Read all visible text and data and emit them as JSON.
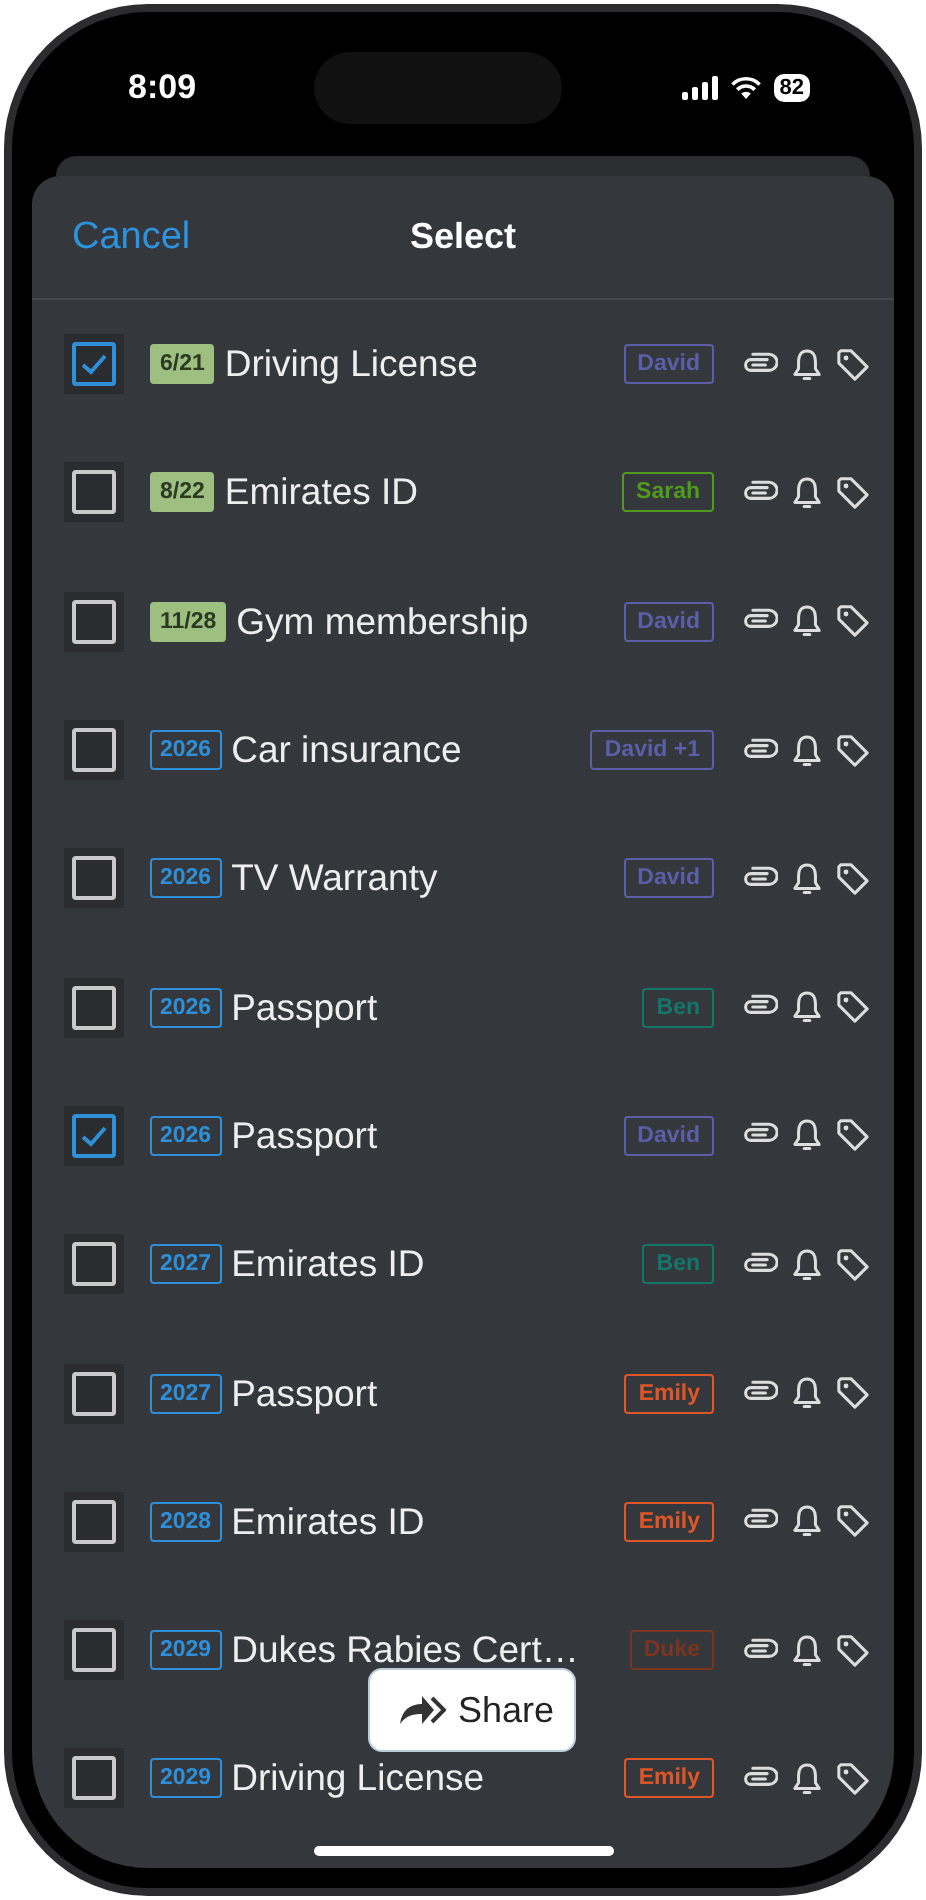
{
  "status_bar": {
    "time": "8:09",
    "battery": "82"
  },
  "header": {
    "cancel": "Cancel",
    "title": "Select"
  },
  "rows": [
    {
      "selected": true,
      "date": {
        "text": "6/21",
        "kind": "month"
      },
      "title": "Driving License",
      "person": "David",
      "color": "#5a5fa8"
    },
    {
      "selected": false,
      "date": {
        "text": "8/22",
        "kind": "month"
      },
      "title": "Emirates ID",
      "person": "Sarah",
      "color": "#4f9a1f"
    },
    {
      "selected": false,
      "date": {
        "text": "11/28",
        "kind": "month"
      },
      "title": "Gym membership",
      "person": "David",
      "color": "#5a5fa8"
    },
    {
      "selected": false,
      "date": {
        "text": "2026",
        "kind": "year"
      },
      "title": "Car insurance",
      "person": "David +1",
      "color": "#5a5fa8"
    },
    {
      "selected": false,
      "date": {
        "text": "2026",
        "kind": "year"
      },
      "title": "TV Warranty",
      "person": "David",
      "color": "#5a5fa8"
    },
    {
      "selected": false,
      "date": {
        "text": "2026",
        "kind": "year"
      },
      "title": "Passport",
      "person": "Ben",
      "color": "#14756a"
    },
    {
      "selected": true,
      "date": {
        "text": "2026",
        "kind": "year"
      },
      "title": "Passport",
      "person": "David",
      "color": "#5a5fa8"
    },
    {
      "selected": false,
      "date": {
        "text": "2027",
        "kind": "year"
      },
      "title": "Emirates ID",
      "person": "Ben",
      "color": "#14756a"
    },
    {
      "selected": false,
      "date": {
        "text": "2027",
        "kind": "year"
      },
      "title": "Passport",
      "person": "Emily",
      "color": "#e0562b"
    },
    {
      "selected": false,
      "date": {
        "text": "2028",
        "kind": "year"
      },
      "title": "Emirates ID",
      "person": "Emily",
      "color": "#e0562b"
    },
    {
      "selected": false,
      "date": {
        "text": "2029",
        "kind": "year"
      },
      "title": "Dukes Rabies Cert…",
      "person": "Duke",
      "color": "#7a3520"
    },
    {
      "selected": false,
      "date": {
        "text": "2029",
        "kind": "year"
      },
      "title": "Driving License",
      "person": "Emily",
      "color": "#e0562b"
    }
  ],
  "share_button": {
    "label": "Share"
  }
}
